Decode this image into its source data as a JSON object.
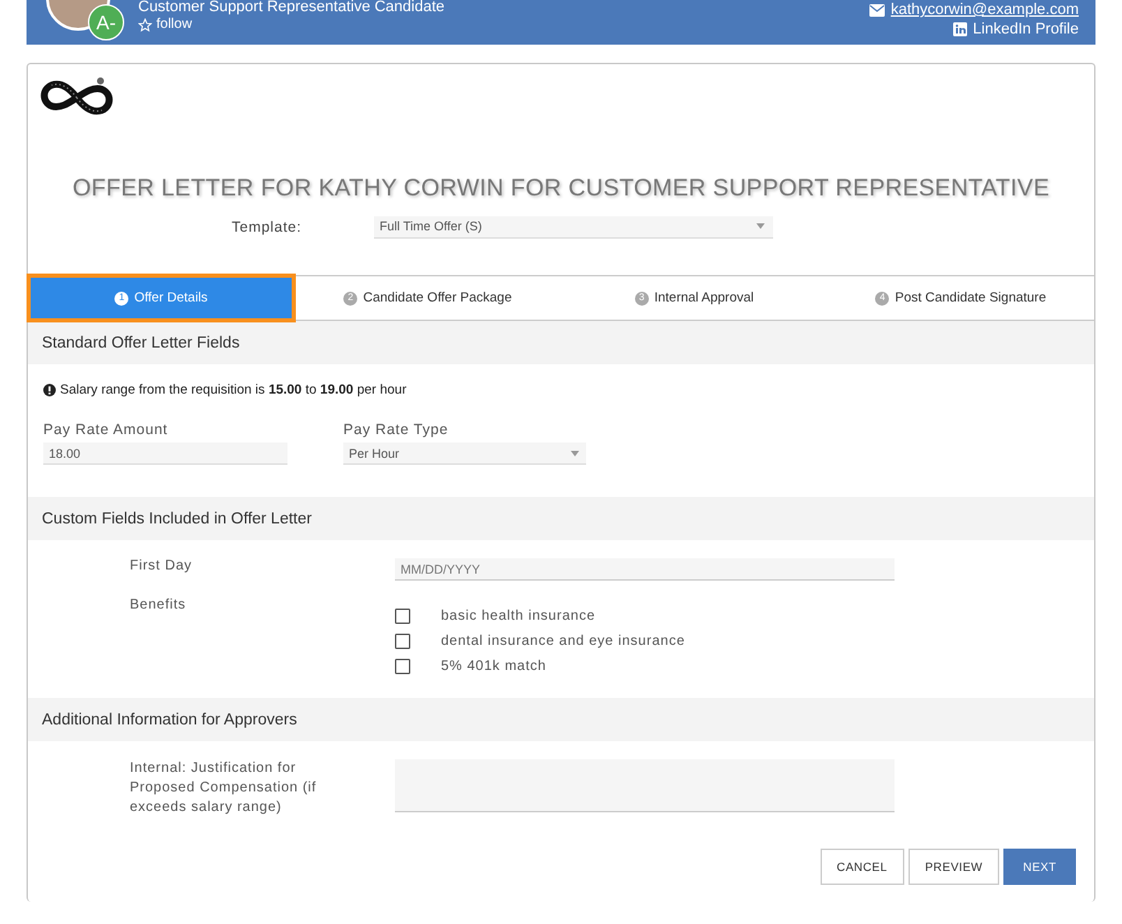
{
  "header": {
    "title": "Customer Support Representative Candidate",
    "badge": "A-",
    "follow": "follow",
    "email": "kathycorwin@example.com",
    "linkedin": "LinkedIn Profile"
  },
  "title": "OFFER LETTER FOR KATHY CORWIN FOR CUSTOMER SUPPORT REPRESENTATIVE",
  "template": {
    "label": "Template:",
    "value": "Full Time Offer (S)"
  },
  "steps": [
    {
      "number": "1",
      "label": "Offer Details",
      "selected": true
    },
    {
      "number": "2",
      "label": "Candidate Offer Package",
      "selected": false
    },
    {
      "number": "3",
      "label": "Internal Approval",
      "selected": false
    },
    {
      "number": "4",
      "label": "Post Candidate Signature",
      "selected": false
    }
  ],
  "standard": {
    "title": "Standard Offer Letter Fields",
    "note": "Salary range from the requisition is **15.00** to **19.00** per hour",
    "fields": [
      {
        "kind": "text",
        "label": "Pay Rate Amount",
        "value": "18.00"
      },
      {
        "kind": "select",
        "label": "Pay Rate Type",
        "value": "Per Hour"
      }
    ]
  },
  "custom": {
    "title": "Custom Fields Included in Offer Letter",
    "first_day": {
      "label": "First Day",
      "placeholder": "MM/DD/YYYY"
    },
    "benefits": {
      "label": "Benefits",
      "options": [
        {
          "label": "basic health insurance",
          "checked": false
        },
        {
          "label": "dental insurance and eye insurance",
          "checked": false
        },
        {
          "label": "5% 401k match",
          "checked": false
        }
      ]
    }
  },
  "approvers": {
    "title": "Additional Information for Approvers",
    "label": "Internal: Justification for Proposed Compensation (if exceeds salary range)"
  },
  "buttons": [
    {
      "kind": "default",
      "label": "CANCEL"
    },
    {
      "kind": "default",
      "label": "PREVIEW"
    },
    {
      "kind": "primary",
      "label": "NEXT"
    }
  ]
}
